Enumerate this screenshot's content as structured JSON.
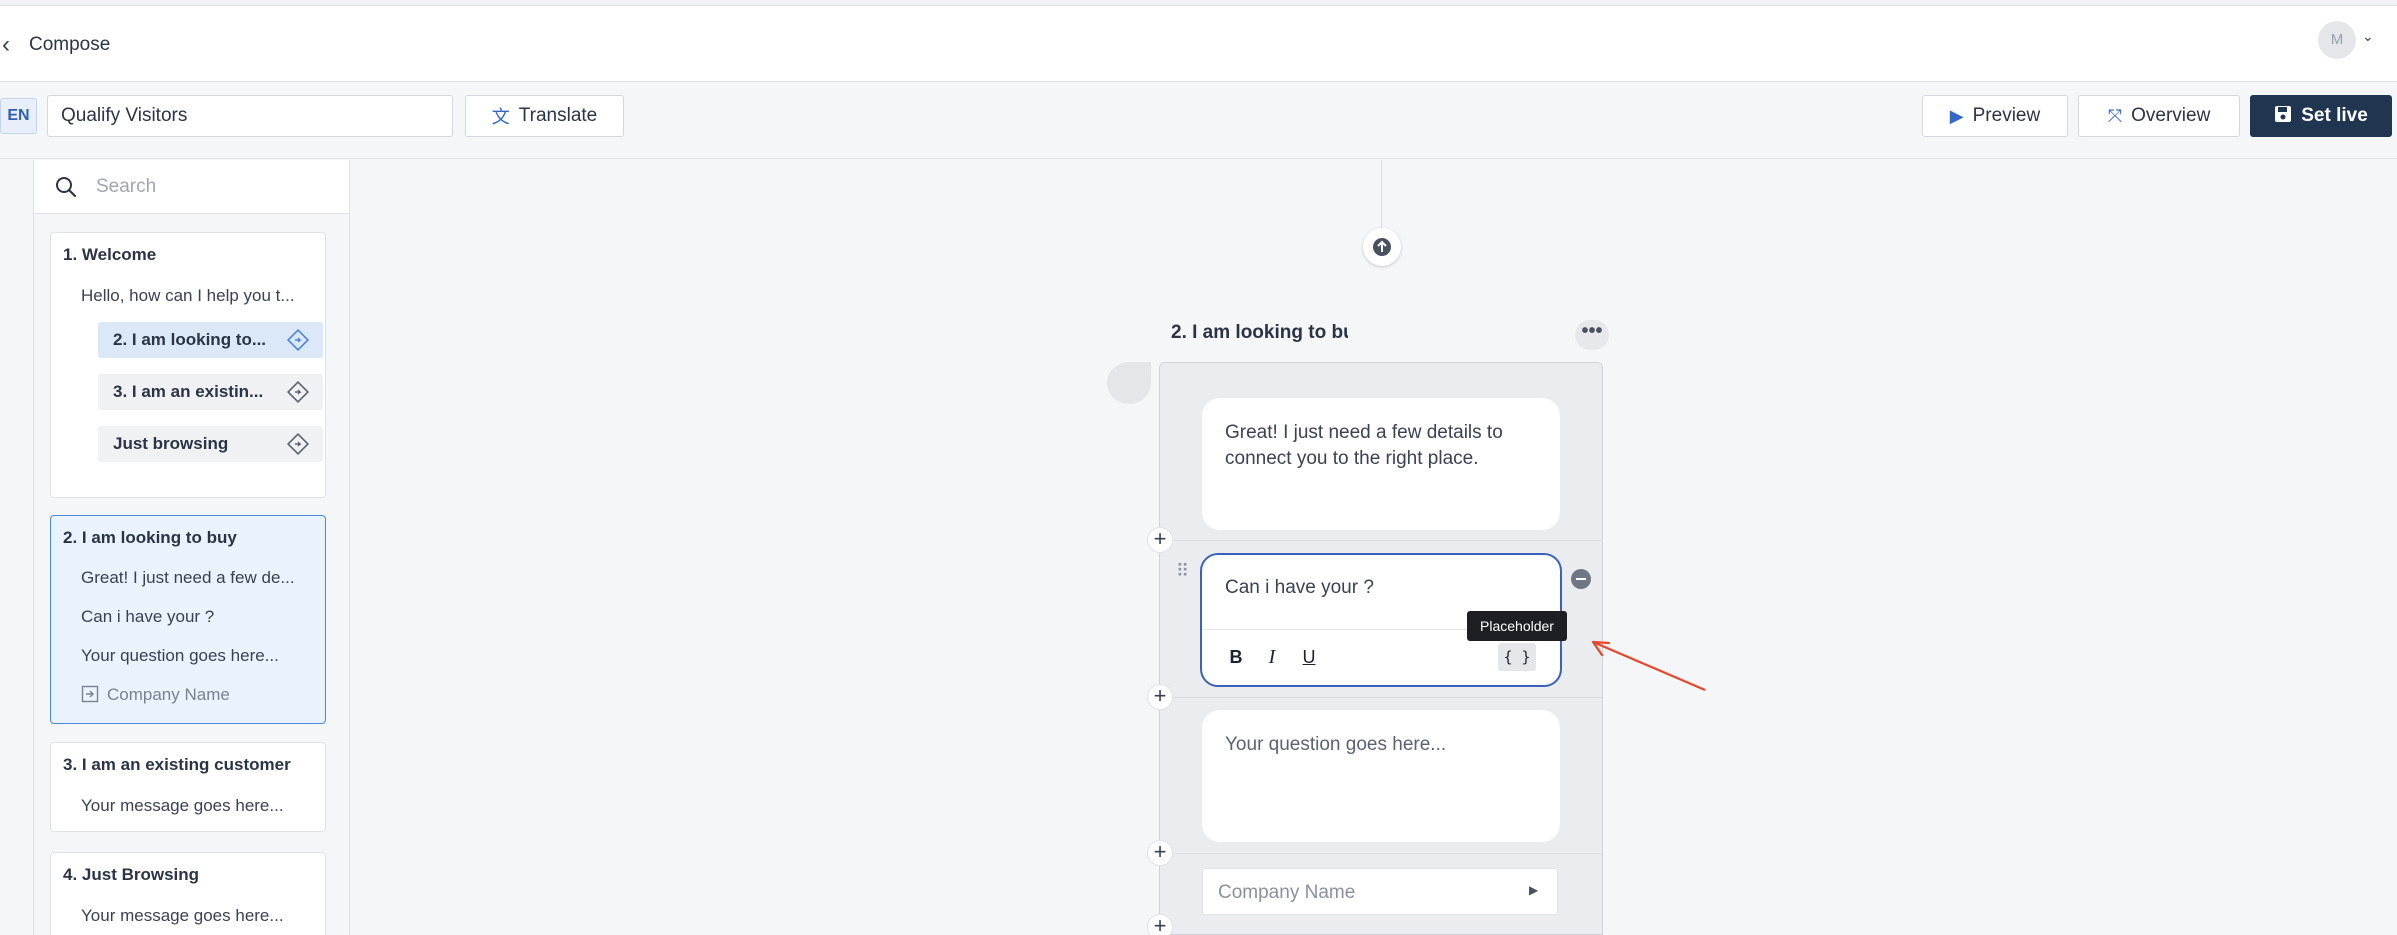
{
  "header": {
    "title": "Compose",
    "avatar_initial": "M"
  },
  "toolbar": {
    "language": "EN",
    "flow_name": "Qualify Visitors",
    "translate_label": "Translate",
    "preview_label": "Preview",
    "overview_label": "Overview",
    "set_live_label": "Set live",
    "accent_color": "#3466c2",
    "primary_button_color": "#1f3550"
  },
  "sidebar": {
    "search_placeholder": "Search",
    "cards": [
      {
        "title": "1. Welcome",
        "lines": [
          "Hello, how can I help you t..."
        ],
        "options": [
          "2. I am looking to...",
          "3. I am an existin...",
          "Just browsing"
        ]
      },
      {
        "title": "2. I am looking to buy",
        "lines": [
          "Great! I just need a few de...",
          "Can i have your  ?",
          "Your question goes here..."
        ],
        "input_field": "Company Name"
      },
      {
        "title": "3. I am an existing customer",
        "lines": [
          "Your message goes here..."
        ]
      },
      {
        "title": "4. Just Browsing",
        "lines": [
          "Your message goes here..."
        ]
      }
    ]
  },
  "editor": {
    "node_title": "2. I am looking to bu",
    "message_1": "Great! I just need a few details to connect you to the right place.",
    "message_2": "Can i have your  ?",
    "message_3": "Your question goes here...",
    "input_field_label": "Company Name",
    "format_bold": "B",
    "format_italic": "I",
    "format_underline": "U",
    "format_placeholder": "{ }",
    "tooltip": "Placeholder",
    "more_label": "•••",
    "annotation_color": "#e8462a"
  }
}
